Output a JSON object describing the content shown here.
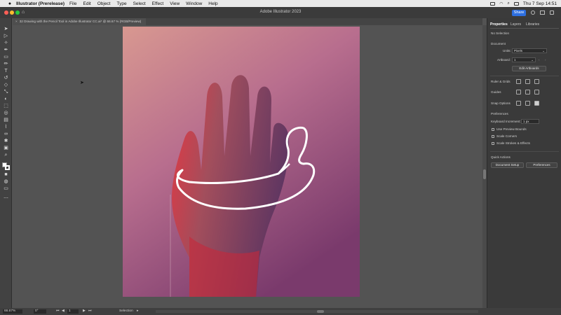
{
  "menubar": {
    "app_name": "Illustrator (Prerelease)",
    "items": [
      "File",
      "Edit",
      "Object",
      "Type",
      "Select",
      "Effect",
      "View",
      "Window",
      "Help"
    ],
    "datetime": "Thu 7 Sep  14:51"
  },
  "titlebar": {
    "title": "Adobe Illustrator 2023",
    "share_label": "Share"
  },
  "document_tab": {
    "label": "32 Drawing with the Pencil Tool in Adobe Illustrator CC.ai* @ 66.67 % (RGB/Preview)"
  },
  "statusbar": {
    "zoom": "66.67%",
    "rotation": "0°",
    "artboard_num": "1",
    "tool_name": "Selection"
  },
  "properties": {
    "tabs": [
      "Properties",
      "Layers",
      "Libraries"
    ],
    "no_selection": "No Selection",
    "document_heading": "Document",
    "units_label": "Units:",
    "units_value": "Pixels",
    "artboard_label": "Artboard:",
    "artboard_value": "1",
    "edit_artboards": "Edit Artboards",
    "ruler_grids": "Ruler & Grids",
    "guides": "Guides",
    "snap_options": "Snap Options",
    "preferences_heading": "Preferences",
    "keyboard_increment_label": "Keyboard Increment:",
    "keyboard_increment_value": "1 px",
    "use_preview_bounds": "Use Preview Bounds",
    "scale_corners": "Scale Corners",
    "scale_strokes": "Scale Strokes & Effects",
    "quick_actions_heading": "Quick Actions",
    "document_setup": "Document Setup",
    "preferences_button": "Preferences"
  },
  "colors": {
    "share_blue": "#2d6fe0",
    "panel_bg": "#3a3a3a",
    "canvas_bg": "#535353",
    "stroke_white": "#ffffff"
  }
}
